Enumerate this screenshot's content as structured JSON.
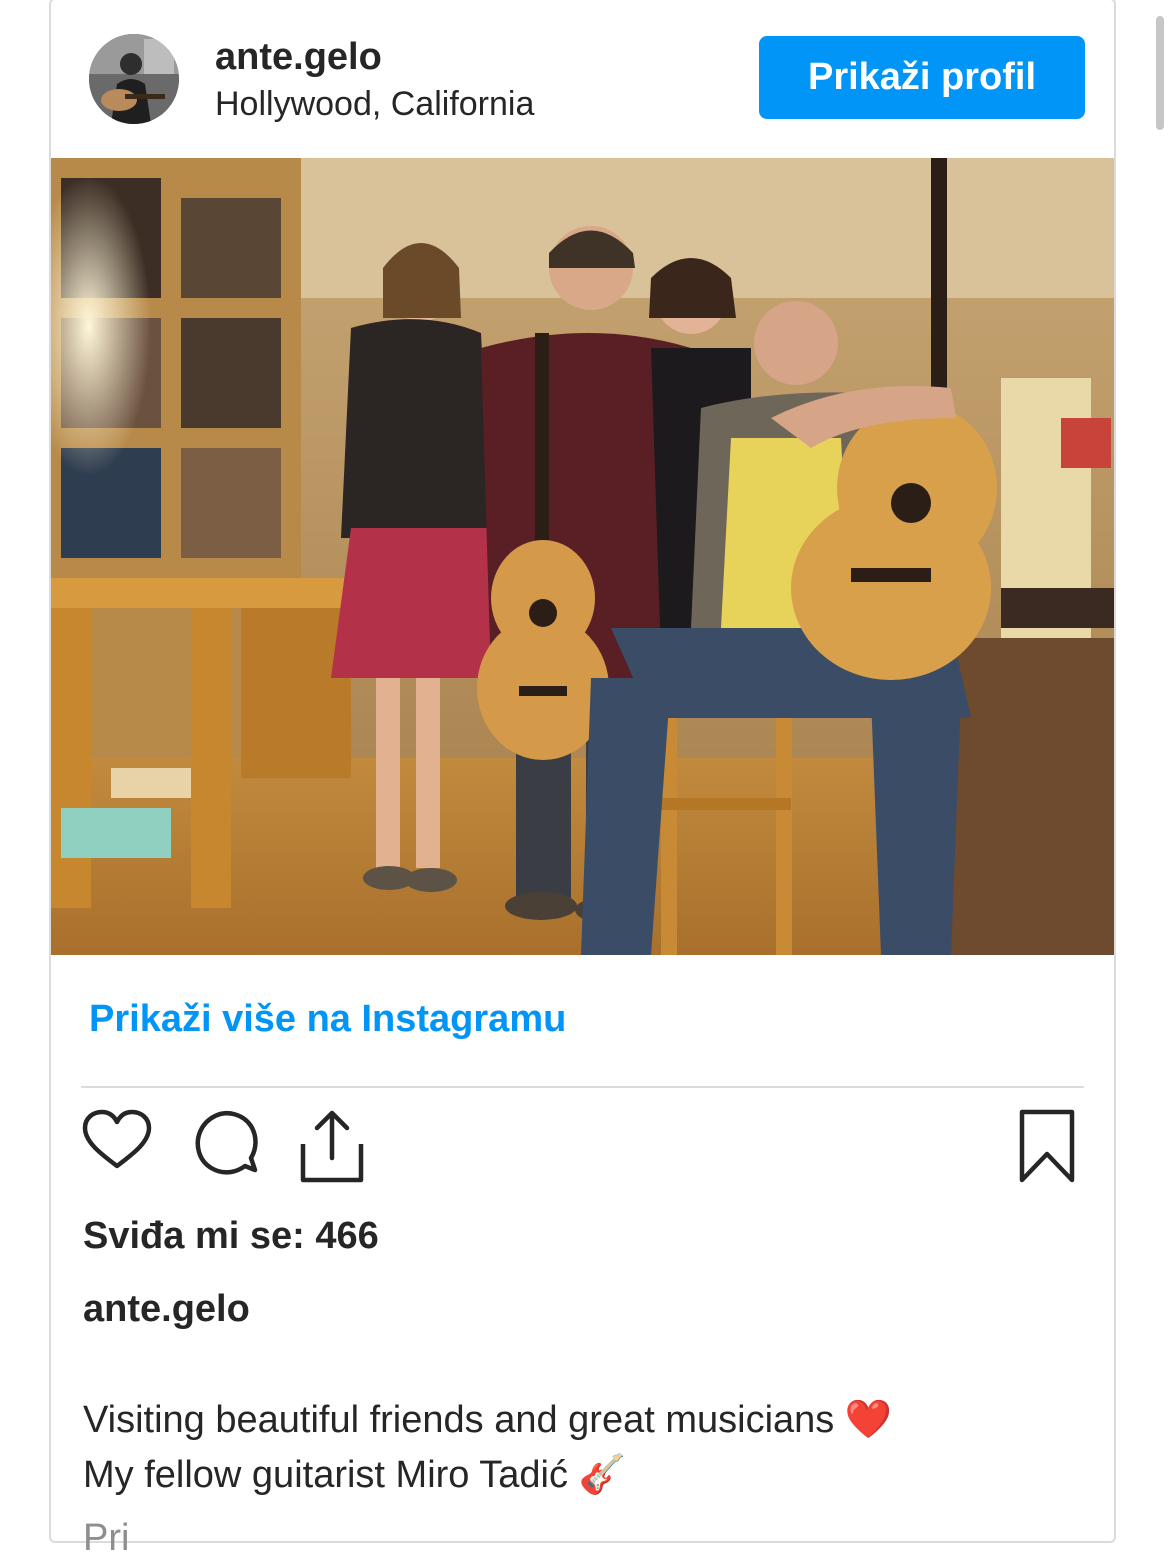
{
  "header": {
    "username": "ante.gelo",
    "location": "Hollywood, California",
    "profile_button": "Prikaži profil"
  },
  "post": {
    "image_alt": "Four people posing with two classical guitars in a room with bookshelves",
    "view_more_link": "Prikaži više na Instagramu",
    "likes": "Sviđa mi se: 466",
    "caption_user": "ante.gelo",
    "caption_line1": "Visiting beautiful friends and great musicians ❤️",
    "caption_line2": "My fellow guitarist Miro Tadić 🎸",
    "more_comments": "Pri"
  },
  "icons": {
    "like": "heart-icon",
    "comment": "comment-icon",
    "share": "share-icon",
    "save": "bookmark-icon"
  },
  "colors": {
    "accent": "#0095f6",
    "text": "#262626",
    "border": "#dbdbdb",
    "muted": "#8e8e8e"
  }
}
